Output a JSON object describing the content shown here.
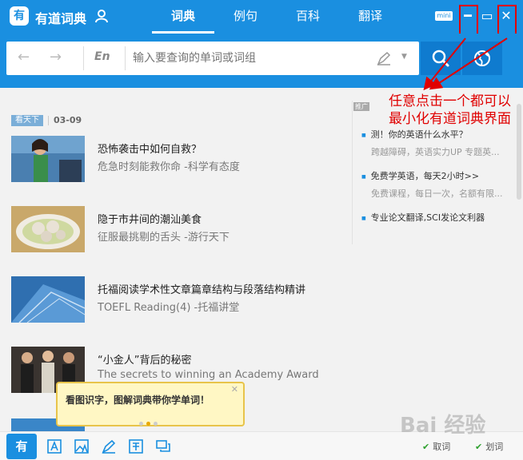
{
  "app": {
    "logo_glyph": "有",
    "title": "有道词典"
  },
  "tabs": [
    {
      "label": "词典",
      "active": true
    },
    {
      "label": "例句",
      "active": false
    },
    {
      "label": "百科",
      "active": false
    },
    {
      "label": "翻译",
      "active": false
    }
  ],
  "window": {
    "mini_label": "mini",
    "minimize_glyph": "━",
    "maximize_glyph": "▭",
    "close_glyph": "✕"
  },
  "search": {
    "back_glyph": "←",
    "forward_glyph": "→",
    "lang": "En",
    "placeholder": "输入要查询的单词或词组",
    "icons": [
      "pen-icon",
      "dropdown-icon",
      "search-icon",
      "globe-icon"
    ]
  },
  "annotation": {
    "text": "任意点击一个都可以最小化有道词典界面"
  },
  "feed": {
    "badge": "看天下",
    "date": "03-09",
    "items": [
      {
        "title": "恐怖袭击中如何自救？",
        "subtitle": "危急时刻能救你命 -科学有态度"
      },
      {
        "title": "隐于市井间的潮汕美食",
        "subtitle": "征服最挑剔的舌头 -游行天下"
      },
      {
        "title": "托福阅读学术性文章篇章结构与段落结构精讲",
        "subtitle": "TOEFL Reading(4) -托福讲堂"
      },
      {
        "title": "“小金人”背后的秘密",
        "subtitle": "The secrets to winning an Academy Award"
      }
    ]
  },
  "ads": {
    "label": "推广",
    "items": [
      {
        "title": "测！你的英语什么水平？",
        "subtitle": "跨越障碍，英语实力UP 专题英..."
      },
      {
        "title": "免费学英语，每天2小时>>",
        "subtitle": "免费课程，每日一次，名额有限..."
      },
      {
        "title": "专业论文翻译,SCI发论文利器",
        "subtitle": ""
      }
    ]
  },
  "tooltip": {
    "text": "看图识字，图解词典带你学单词！",
    "close_glyph": "✕"
  },
  "bottom": {
    "logo_glyph": "有",
    "icons": [
      "text-a-icon",
      "image-a-icon",
      "pen-icon",
      "translate-icon",
      "chat-icon"
    ],
    "checks": [
      {
        "label": "取词"
      },
      {
        "label": "划词"
      }
    ]
  },
  "watermark": "Bai 经验",
  "colors": {
    "brand": "#1a8fe0",
    "annotation": "#e00000"
  }
}
